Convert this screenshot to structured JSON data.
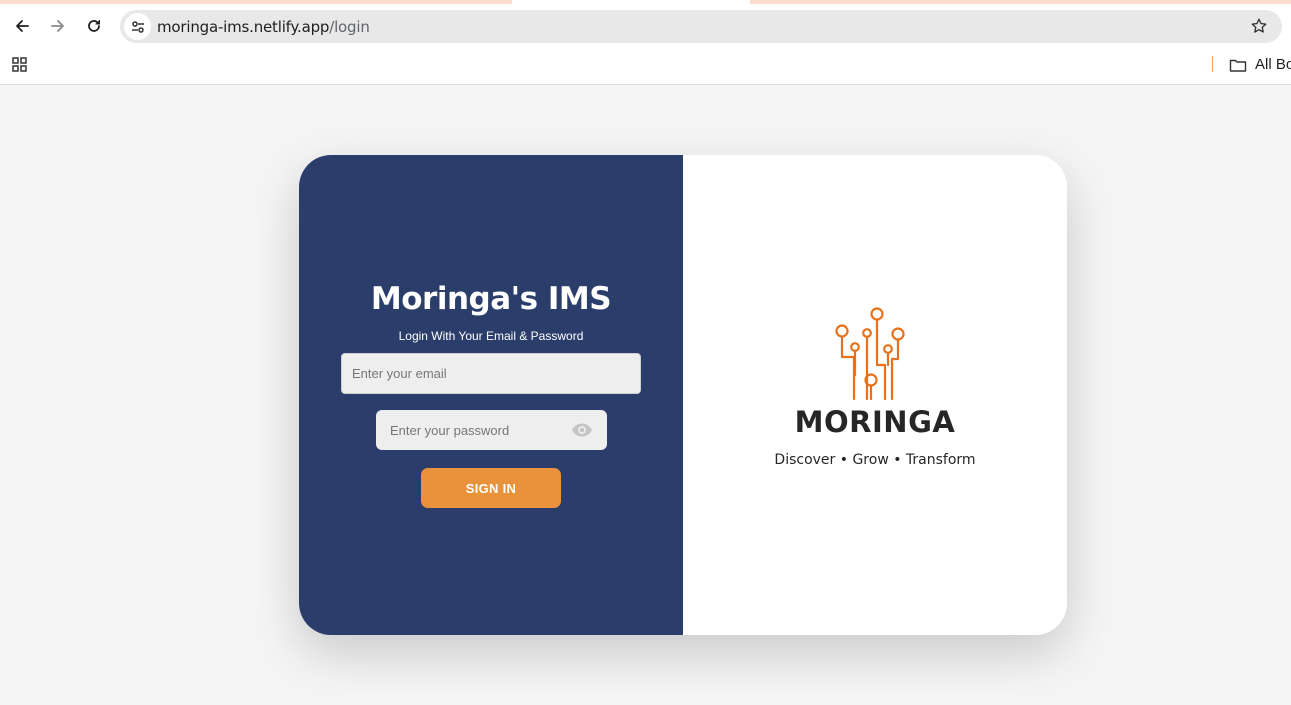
{
  "browser": {
    "url_host": "moringa-ims.netlify.app",
    "url_path": "/login",
    "bookmarks_label": "All Bo",
    "accent": "#f9dccb"
  },
  "login": {
    "title": "Moringa's IMS",
    "subtitle": "Login With Your Email & Password",
    "email_placeholder": "Enter your email",
    "password_placeholder": "Enter your password",
    "signin_label": "SIGN IN",
    "panel_color": "#2b3e6b",
    "button_color": "#e8923b"
  },
  "brand": {
    "name": "MORINGA",
    "tagline": "Discover • Grow • Transform",
    "logo_icon": "circuit-tree-logo",
    "logo_color": "#e8711a"
  }
}
